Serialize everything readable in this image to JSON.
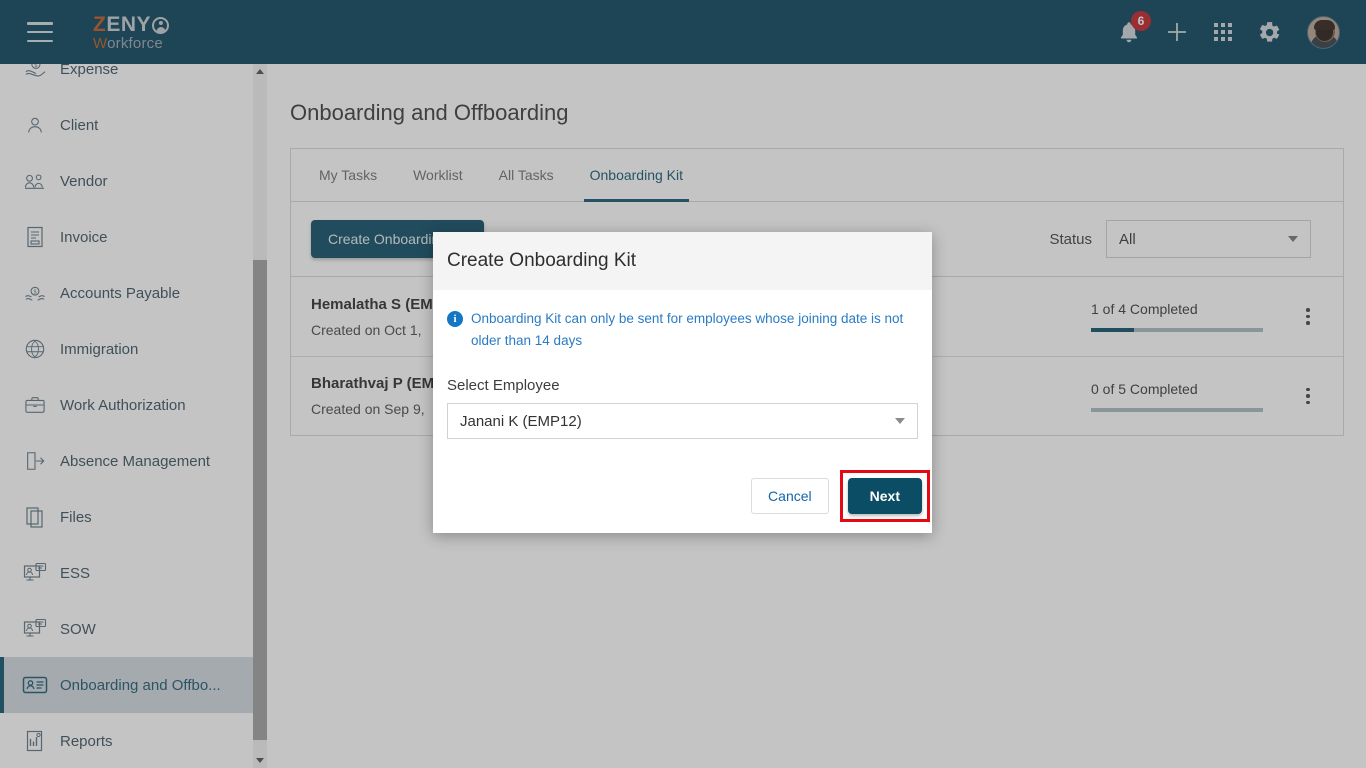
{
  "header": {
    "logo": {
      "brand_first": "Z",
      "brand_rest": "ENY",
      "sub_first": "W",
      "sub_rest": "orkforce"
    },
    "notification_count": "6",
    "icons": [
      "bell-icon",
      "plus-icon",
      "apps-grid-icon",
      "gear-icon",
      "avatar"
    ]
  },
  "sidebar": {
    "items": [
      {
        "label": "Expense",
        "icon": "expense-icon",
        "active": false
      },
      {
        "label": "Client",
        "icon": "client-person-icon",
        "active": false
      },
      {
        "label": "Vendor",
        "icon": "vendor-icon",
        "active": false
      },
      {
        "label": "Invoice",
        "icon": "invoice-icon",
        "active": false
      },
      {
        "label": "Accounts Payable",
        "icon": "accounts-payable-icon",
        "active": false
      },
      {
        "label": "Immigration",
        "icon": "immigration-globe-icon",
        "active": false
      },
      {
        "label": "Work Authorization",
        "icon": "briefcase-icon",
        "active": false
      },
      {
        "label": "Absence Management",
        "icon": "door-exit-icon",
        "active": false
      },
      {
        "label": "Files",
        "icon": "files-icon",
        "active": false
      },
      {
        "label": "ESS",
        "icon": "ess-monitor-icon",
        "active": false
      },
      {
        "label": "SOW",
        "icon": "sow-monitor-icon",
        "active": false
      },
      {
        "label": "Onboarding and Offbo...",
        "icon": "id-card-icon",
        "active": true
      },
      {
        "label": "Reports",
        "icon": "reports-icon",
        "active": false
      }
    ]
  },
  "main": {
    "page_title": "Onboarding and Offboarding",
    "tabs": [
      {
        "label": "My Tasks",
        "active": false
      },
      {
        "label": "Worklist",
        "active": false
      },
      {
        "label": "All Tasks",
        "active": false
      },
      {
        "label": "Onboarding Kit",
        "active": true
      }
    ],
    "create_button": "Create Onboarding Kit",
    "status_label": "Status",
    "status_value": "All",
    "rows": [
      {
        "name": "Hemalatha S (EM",
        "created": "Created on Oct 1,",
        "progress_text": "1 of 4 Completed",
        "progress_percent": 25
      },
      {
        "name": "Bharathvaj P (EM",
        "created": "Created on Sep 9,",
        "progress_text": "0 of 5 Completed",
        "progress_percent": 0
      }
    ]
  },
  "modal": {
    "title": "Create Onboarding Kit",
    "info_text": "Onboarding Kit can only be sent for employees whose joining date is not older than 14 days",
    "info_icon": "info-circle-icon",
    "field_label": "Select Employee",
    "field_value": "Janani K (EMP12)",
    "cancel_label": "Cancel",
    "next_label": "Next"
  },
  "colors": {
    "brand_dark": "#06425c",
    "accent_orange": "#c2571f",
    "button_teal": "#0c4d66",
    "info_blue": "#2a7bc4",
    "highlight_red": "#e50914"
  }
}
